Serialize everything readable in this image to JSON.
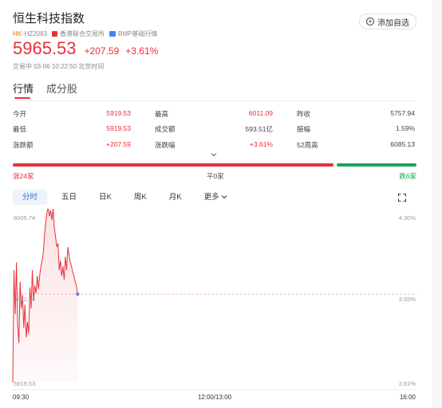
{
  "header": {
    "title": "恒生科技指数",
    "market_tag": "HK",
    "code": "HZ2083",
    "exchange": "香港联合交易所",
    "quote_type": "BMP基础行情",
    "watch_label": "添加自选"
  },
  "quote": {
    "price": "5965.53",
    "change": "+207.59",
    "change_pct": "+3.61%",
    "status_time": "交易中 03-06 10:22:50 北京时间"
  },
  "tabs": [
    {
      "label": "行情",
      "active": true
    },
    {
      "label": "成分股",
      "active": false
    }
  ],
  "stats": [
    [
      {
        "label": "今开",
        "value": "5919.53",
        "color": "red"
      },
      {
        "label": "最高",
        "value": "6011.09",
        "color": "red"
      },
      {
        "label": "昨收",
        "value": "5757.94",
        "color": "normal"
      }
    ],
    [
      {
        "label": "最低",
        "value": "5919.53",
        "color": "red"
      },
      {
        "label": "成交额",
        "value": "593.51亿",
        "color": "normal"
      },
      {
        "label": "振幅",
        "value": "1.59%",
        "color": "normal"
      }
    ],
    [
      {
        "label": "涨跌额",
        "value": "+207.59",
        "color": "red"
      },
      {
        "label": "涨跌幅",
        "value": "+3.61%",
        "color": "red"
      },
      {
        "label": "52周高",
        "value": "6085.13",
        "color": "normal"
      }
    ]
  ],
  "breadth": {
    "up_label": "涨24家",
    "flat_label": "平0家",
    "down_label": "跌6家",
    "up": 24,
    "flat": 0,
    "down": 6
  },
  "periods": [
    {
      "label": "分时",
      "active": true
    },
    {
      "label": "五日",
      "active": false
    },
    {
      "label": "日K",
      "active": false
    },
    {
      "label": "周K",
      "active": false
    },
    {
      "label": "月K",
      "active": false
    },
    {
      "label": "更多",
      "active": false
    }
  ],
  "colors": {
    "up": "#e8303a",
    "down": "#1aa35a",
    "accent": "#3b6fd8"
  },
  "chart_data": {
    "type": "line",
    "y_left_labels": [
      "6005.74",
      "5862.64",
      "5919.53"
    ],
    "y_right_labels": [
      "4.30%",
      "3.55%",
      "2.81%"
    ],
    "ylim": [
      5919.53,
      6005.74
    ],
    "reference_value": 5965.53,
    "time_labels": [
      "09:30",
      "12:00/13:00",
      "16:00"
    ],
    "session_minutes": 330,
    "x": [
      0,
      1,
      2,
      3,
      4,
      5,
      6,
      7,
      8,
      9,
      10,
      11,
      12,
      13,
      14,
      15,
      16,
      17,
      18,
      19,
      20,
      21,
      22,
      23,
      24,
      25,
      26,
      27,
      28,
      29,
      30,
      31,
      32,
      33,
      34,
      35,
      36,
      37,
      38,
      39,
      40,
      41,
      42,
      43,
      44,
      45,
      46,
      47,
      48,
      49,
      50,
      51,
      52,
      53
    ],
    "values": [
      5919.6,
      5978,
      5955,
      5982,
      5950,
      5940,
      5972,
      5958,
      5965,
      5948,
      5960,
      5943,
      5951,
      5945,
      5969,
      5958,
      5978,
      5962,
      5970,
      5966,
      5975,
      5968,
      5975,
      5980,
      5983,
      5987,
      5997,
      6003,
      6008,
      6011,
      6006,
      6009,
      6004,
      6010,
      6000,
      5995,
      5990,
      5992,
      5978,
      5983,
      5975,
      5980,
      5973,
      5985,
      5978,
      5990,
      5986,
      5982,
      5980,
      5977,
      5975,
      5972,
      5970,
      5965.53
    ]
  }
}
